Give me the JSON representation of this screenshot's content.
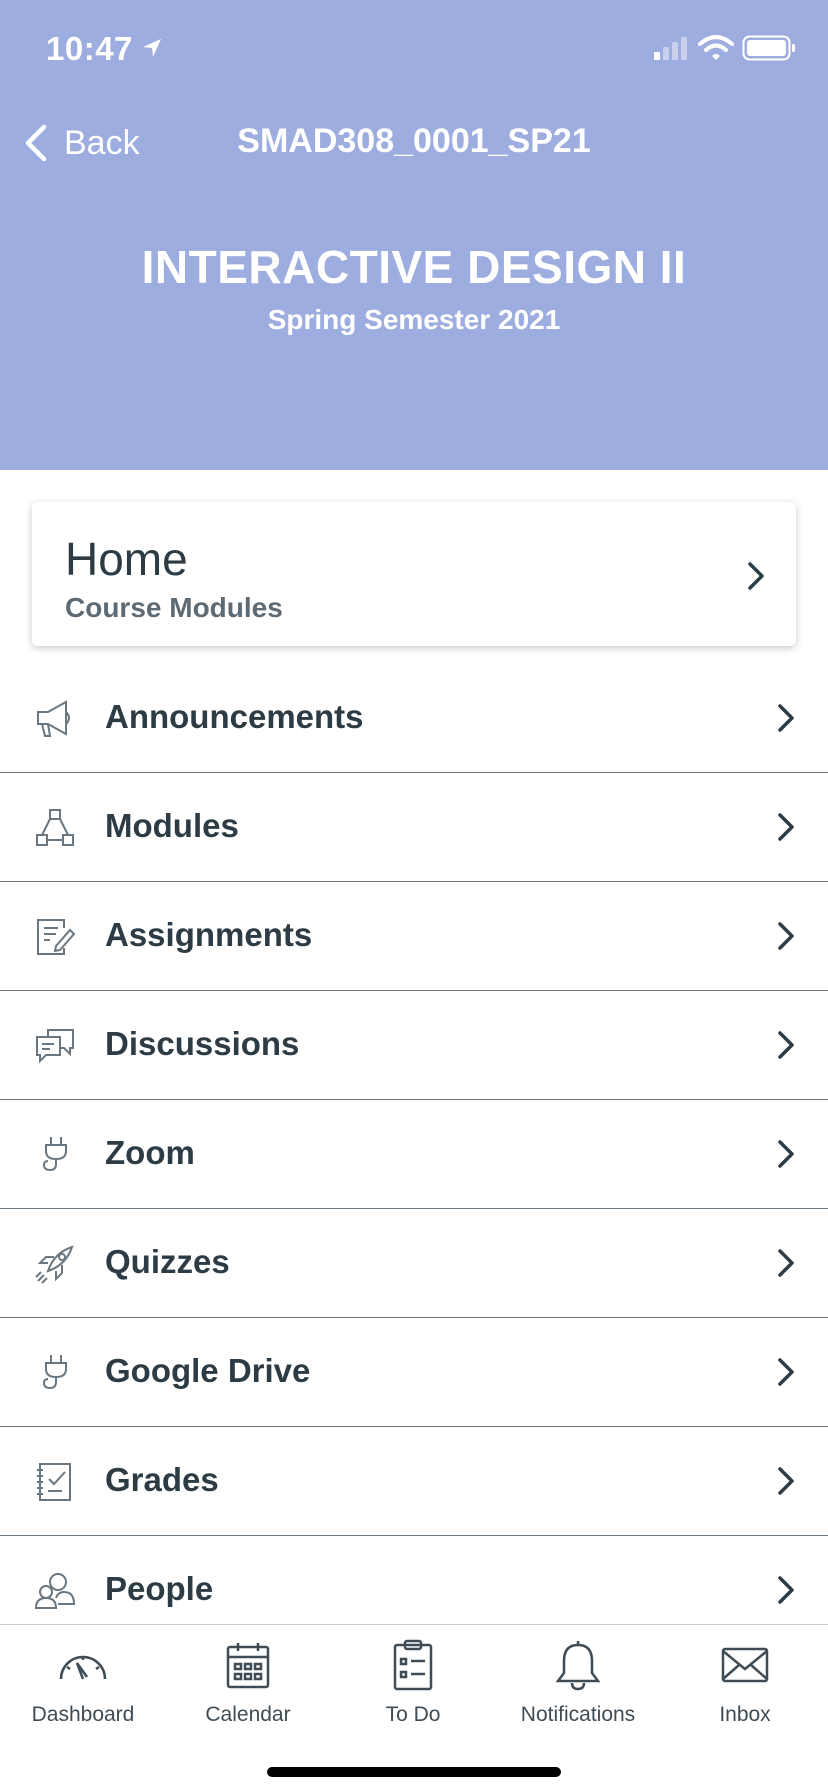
{
  "status_bar": {
    "time": "10:47"
  },
  "nav": {
    "back_label": "Back",
    "title": "SMAD308_0001_SP21"
  },
  "course": {
    "title": "INTERACTIVE DESIGN II",
    "subtitle": "Spring Semester 2021"
  },
  "home_card": {
    "title": "Home",
    "subtitle": "Course Modules"
  },
  "menu": {
    "items": [
      {
        "label": "Announcements",
        "icon": "megaphone-icon"
      },
      {
        "label": "Modules",
        "icon": "modules-icon"
      },
      {
        "label": "Assignments",
        "icon": "assignment-icon"
      },
      {
        "label": "Discussions",
        "icon": "discussion-icon"
      },
      {
        "label": "Zoom",
        "icon": "plug-icon"
      },
      {
        "label": "Quizzes",
        "icon": "rocket-icon"
      },
      {
        "label": "Google Drive",
        "icon": "plug-icon"
      },
      {
        "label": "Grades",
        "icon": "gradebook-icon"
      },
      {
        "label": "People",
        "icon": "people-icon"
      }
    ]
  },
  "tabbar": {
    "items": [
      {
        "label": "Dashboard",
        "icon": "dashboard-icon"
      },
      {
        "label": "Calendar",
        "icon": "calendar-icon"
      },
      {
        "label": "To Do",
        "icon": "todo-icon"
      },
      {
        "label": "Notifications",
        "icon": "bell-icon"
      },
      {
        "label": "Inbox",
        "icon": "envelope-icon"
      }
    ]
  },
  "colors": {
    "header_bg": "#9eade0",
    "text_dark": "#2d3b45",
    "text_muted": "#5e6a74",
    "icon": "#6b7780"
  }
}
